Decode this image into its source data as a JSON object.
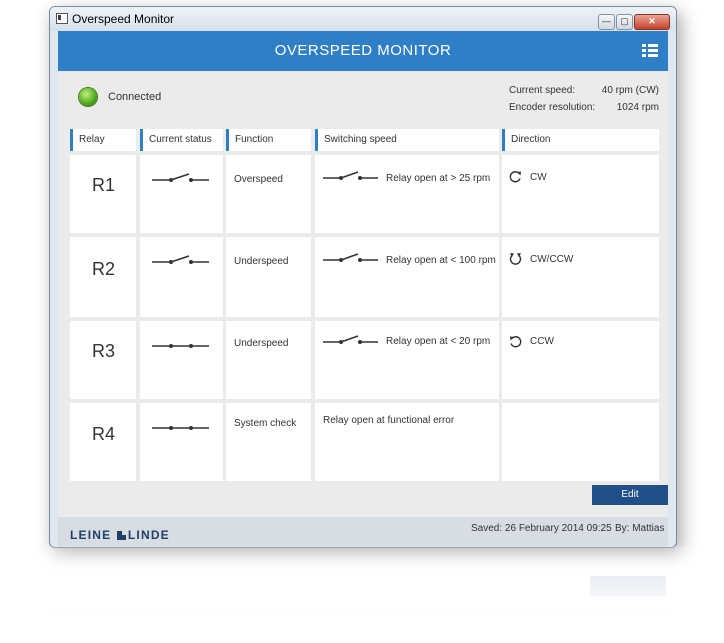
{
  "window": {
    "title": "Overspeed Monitor",
    "controls": {
      "minimize": "—",
      "maximize": "▢",
      "close": "✕"
    }
  },
  "header": {
    "title": "OVERSPEED MONITOR",
    "menu_icon": "menu-grid-icon"
  },
  "status": {
    "connection": "Connected",
    "led_color": "#4fa81c"
  },
  "info": {
    "speed_label": "Current speed:",
    "speed_value": "40 rpm (CW)",
    "resolution_label": "Encoder resolution:",
    "resolution_value": "1024 rpm"
  },
  "table": {
    "headers": [
      "Relay",
      "Current status",
      "Function",
      "Switching speed",
      "Direction"
    ],
    "rows": [
      {
        "relay": "R1",
        "status": "open",
        "function": "Overspeed",
        "switch_icon": "open",
        "switching_text": "Relay open at >  25 rpm",
        "direction_icon": "rotate-cw-icon",
        "direction": "CW"
      },
      {
        "relay": "R2",
        "status": "open",
        "function": "Underspeed",
        "switch_icon": "open",
        "switching_text": "Relay open at <  100 rpm",
        "direction_icon": "rotate-both-icon",
        "direction": "CW/CCW"
      },
      {
        "relay": "R3",
        "status": "closed",
        "function": "Underspeed",
        "switch_icon": "open",
        "switching_text": "Relay open at <  20 rpm",
        "direction_icon": "rotate-ccw-icon",
        "direction": "CCW"
      },
      {
        "relay": "R4",
        "status": "closed",
        "function": "System check",
        "switch_icon": "",
        "switching_text": "Relay open at functional error",
        "direction_icon": "",
        "direction": ""
      }
    ]
  },
  "actions": {
    "edit": "Edit"
  },
  "footer": {
    "logo_left": "LEINE",
    "logo_right": "LINDE",
    "saved": "Saved: 26 February 2014 09:25",
    "by": "By: Mattias"
  },
  "colors": {
    "accent": "#2f7fc7",
    "button": "#1f4f86",
    "background": "#ebebeb"
  }
}
